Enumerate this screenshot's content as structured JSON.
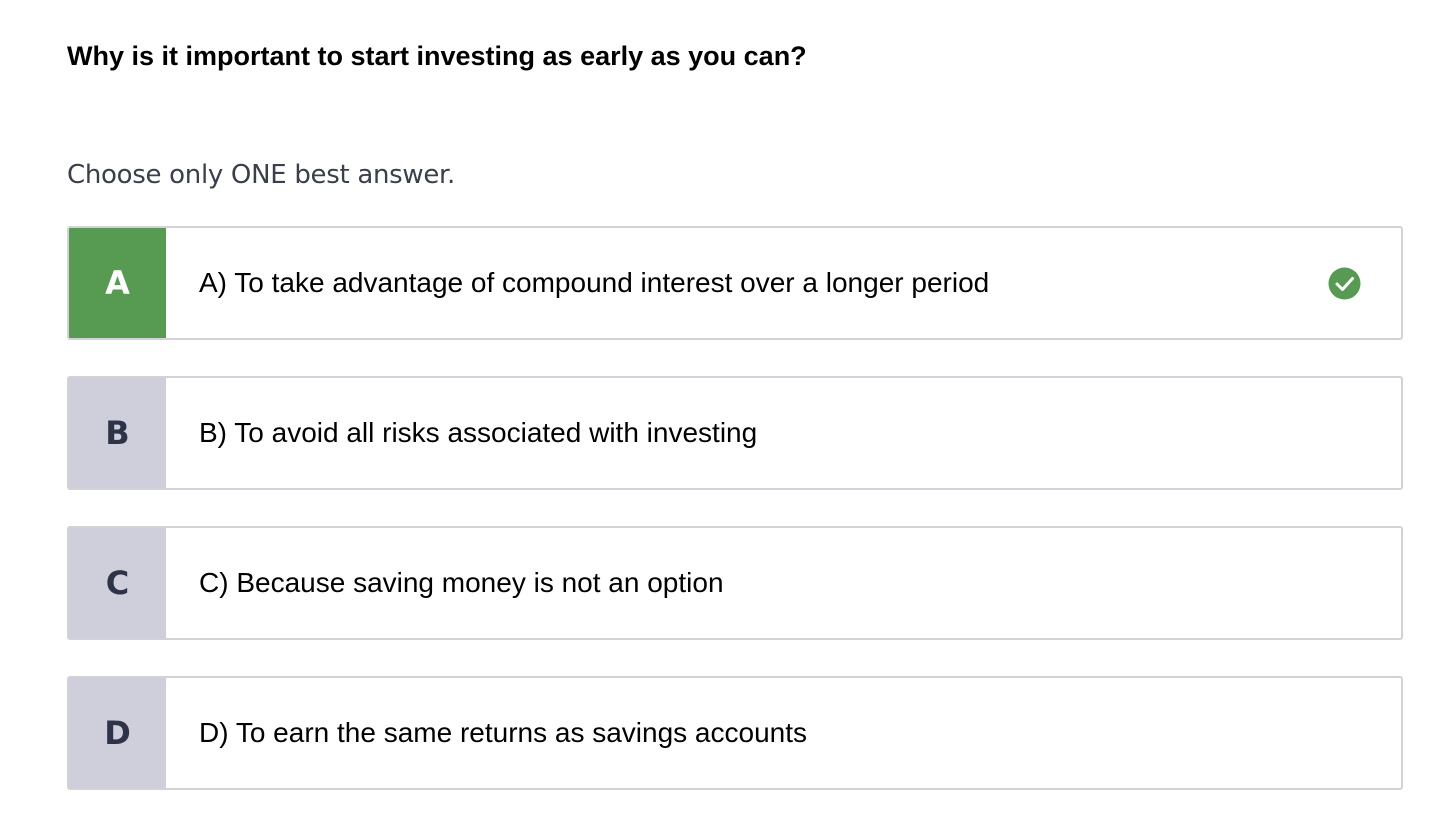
{
  "question": "Why is it important to start investing as early as you can?",
  "instruction": "Choose only ONE best answer.",
  "colors": {
    "selected_accent": "#569b51",
    "letter_background": "#cfcfdb",
    "letter_text": "#2e3447",
    "border": "#d2d2d8"
  },
  "options": [
    {
      "letter": "A",
      "text": "A) To take advantage of compound interest over a longer period",
      "selected": true,
      "icon": "check-circle-icon"
    },
    {
      "letter": "B",
      "text": "B) To avoid all risks associated with investing",
      "selected": false
    },
    {
      "letter": "C",
      "text": "C) Because saving money is not an option",
      "selected": false
    },
    {
      "letter": "D",
      "text": "D) To earn the same returns as savings accounts",
      "selected": false
    }
  ]
}
